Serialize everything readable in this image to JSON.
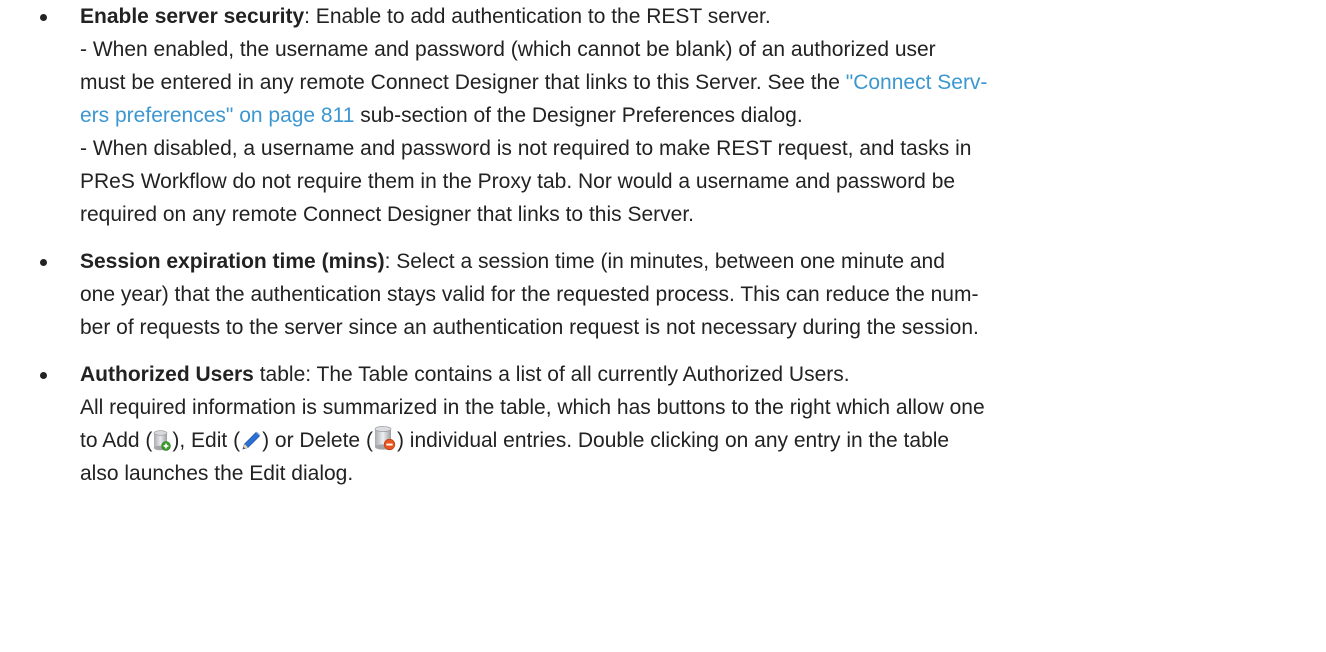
{
  "bullets": [
    {
      "term": "Enable server security",
      "after_term": ": Enable to add authentication to the REST server.",
      "lines": [
        "- When enabled, the username and password (which cannot be blank) of an authorized user",
        "must be entered in any remote Connect Designer that links to this Server. See the "
      ],
      "link_line1": "\"Connect Serv-",
      "link_line2": "ers preferences\" on page 811",
      "after_link": " sub-section of the Designer Preferences dialog.",
      "disabled_lines": [
        "- When disabled, a username and password is not required to make REST request, and tasks in",
        "PReS Workflow do not require them in the Proxy tab. Nor would a username and password be",
        "required on any remote Connect Designer that links to this Server."
      ]
    },
    {
      "term": "Session expiration time (mins)",
      "after_term": ": Select a session time (in minutes, between one minute and",
      "lines": [
        "one year) that the authentication stays valid for the requested process. This can reduce the num-",
        "ber of requests to the server since an authentication request is not necessary during the session."
      ]
    },
    {
      "term": "Authorized Users",
      "after_term": " table: The Table contains a list of all currently Authorized Users.",
      "line2": "All required information is summarized in the table, which has buttons to the right which allow one",
      "to_add": "to Add (",
      "edit_text": "), Edit (",
      "delete_text": ") or Delete (",
      "after_delete": ") individual entries. Double clicking on any entry in the table",
      "last_line": "also launches the Edit dialog.",
      "icons": [
        "add-entry-icon",
        "edit-pencil-icon",
        "delete-entry-icon"
      ]
    }
  ],
  "colors": {
    "text": "#222222",
    "link": "#3c97d1"
  }
}
